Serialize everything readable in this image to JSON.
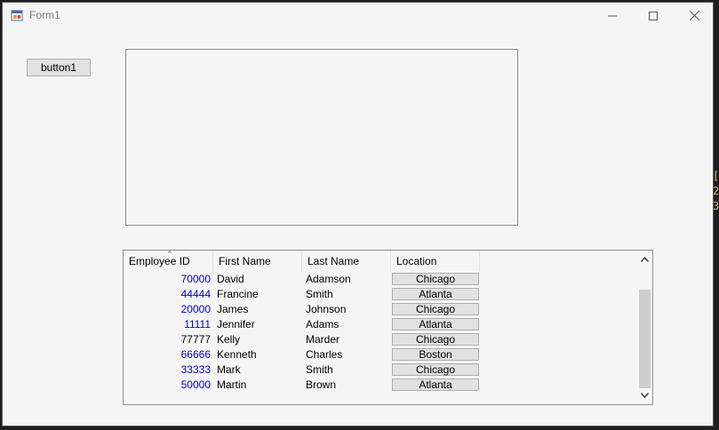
{
  "window": {
    "title": "Form1",
    "controls": {
      "minimize": "minimize-icon",
      "maximize": "maximize-icon",
      "close": "close-icon"
    }
  },
  "button1": {
    "label": "button1"
  },
  "listview": {
    "columns": [
      "Employee ID",
      "First Name",
      "Last Name",
      "Location"
    ],
    "sorted_column": "Employee ID",
    "rows": [
      {
        "id": "70000",
        "first": "David",
        "last": "Adamson",
        "location": "Chicago",
        "id_color": "#0000cc"
      },
      {
        "id": "44444",
        "first": "Francine",
        "last": "Smith",
        "location": "Atlanta",
        "id_color": "#0000cc"
      },
      {
        "id": "20000",
        "first": "James",
        "last": "Johnson",
        "location": "Chicago",
        "id_color": "#0000cc"
      },
      {
        "id": "11111",
        "first": "Jennifer",
        "last": "Adams",
        "location": "Atlanta",
        "id_color": "#0000cc"
      },
      {
        "id": "77777",
        "first": "Kelly",
        "last": "Marder",
        "location": "Chicago",
        "id_color": "#000000"
      },
      {
        "id": "66666",
        "first": "Kenneth",
        "last": "Charles",
        "location": "Boston",
        "id_color": "#0000cc"
      },
      {
        "id": "33333",
        "first": "Mark",
        "last": "Smith",
        "location": "Chicago",
        "id_color": "#0000cc"
      },
      {
        "id": "50000",
        "first": "Martin",
        "last": "Brown",
        "location": "Atlanta",
        "id_color": "#0000cc"
      }
    ]
  },
  "edge_text": [
    "[",
    "2",
    "3"
  ],
  "colors": {
    "window_bg": "#f5f5f5",
    "button_bg": "#e1e1e1",
    "id_blue": "#0000cc",
    "scroll_thumb": "#cdcdcd"
  }
}
